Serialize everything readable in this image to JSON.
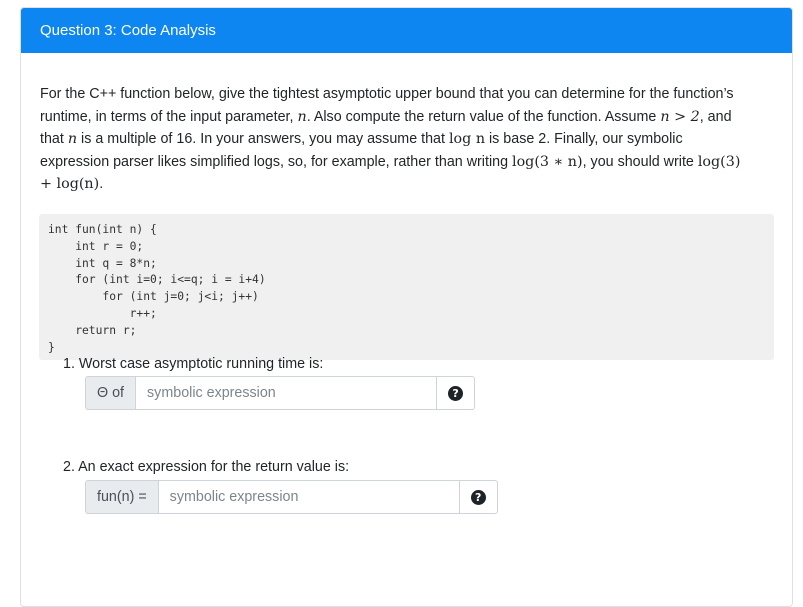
{
  "header": {
    "title": "Question 3: Code Analysis"
  },
  "prompt": {
    "p1": "For the C++ function below, give the tightest asymptotic upper bound that you can determine for the function’s runtime, in terms of the input parameter, ",
    "n": "n",
    "p2": ". Also compute the return value of the function. Assume ",
    "assume_expr": "n > 2",
    "p3": ", and that ",
    "p4": " is a multiple of 16. In your answers, you may assume that ",
    "log_expr": "log n",
    "p5": " is base 2. Finally, our symbolic expression parser likes simplified logs, so, for example, rather than writing ",
    "bad_expr": "log(3 ∗ n)",
    "p6": ", you should write ",
    "good_expr": "log(3) + log(n)",
    "p7": "."
  },
  "code": {
    "lines": [
      "int fun(int n) {",
      "    int r = 0;",
      "    int q = 8*n;",
      "    for (int i=0; i<=q; i = i+4)",
      "        for (int j=0; j<i; j++)",
      "            r++;",
      "    return r;",
      "}"
    ]
  },
  "q1": {
    "label": "1. Worst case asymptotic running time is:",
    "addon": "Θ of",
    "placeholder": "symbolic expression",
    "help": "?"
  },
  "q2": {
    "label": "2. An exact expression for the return value is:",
    "addon": "fun(n) =",
    "placeholder": "symbolic expression",
    "help": "?"
  },
  "colors": {
    "header": "#0d86f1",
    "code_bg": "#f0f0f0",
    "addon_bg": "#e9ecef"
  }
}
